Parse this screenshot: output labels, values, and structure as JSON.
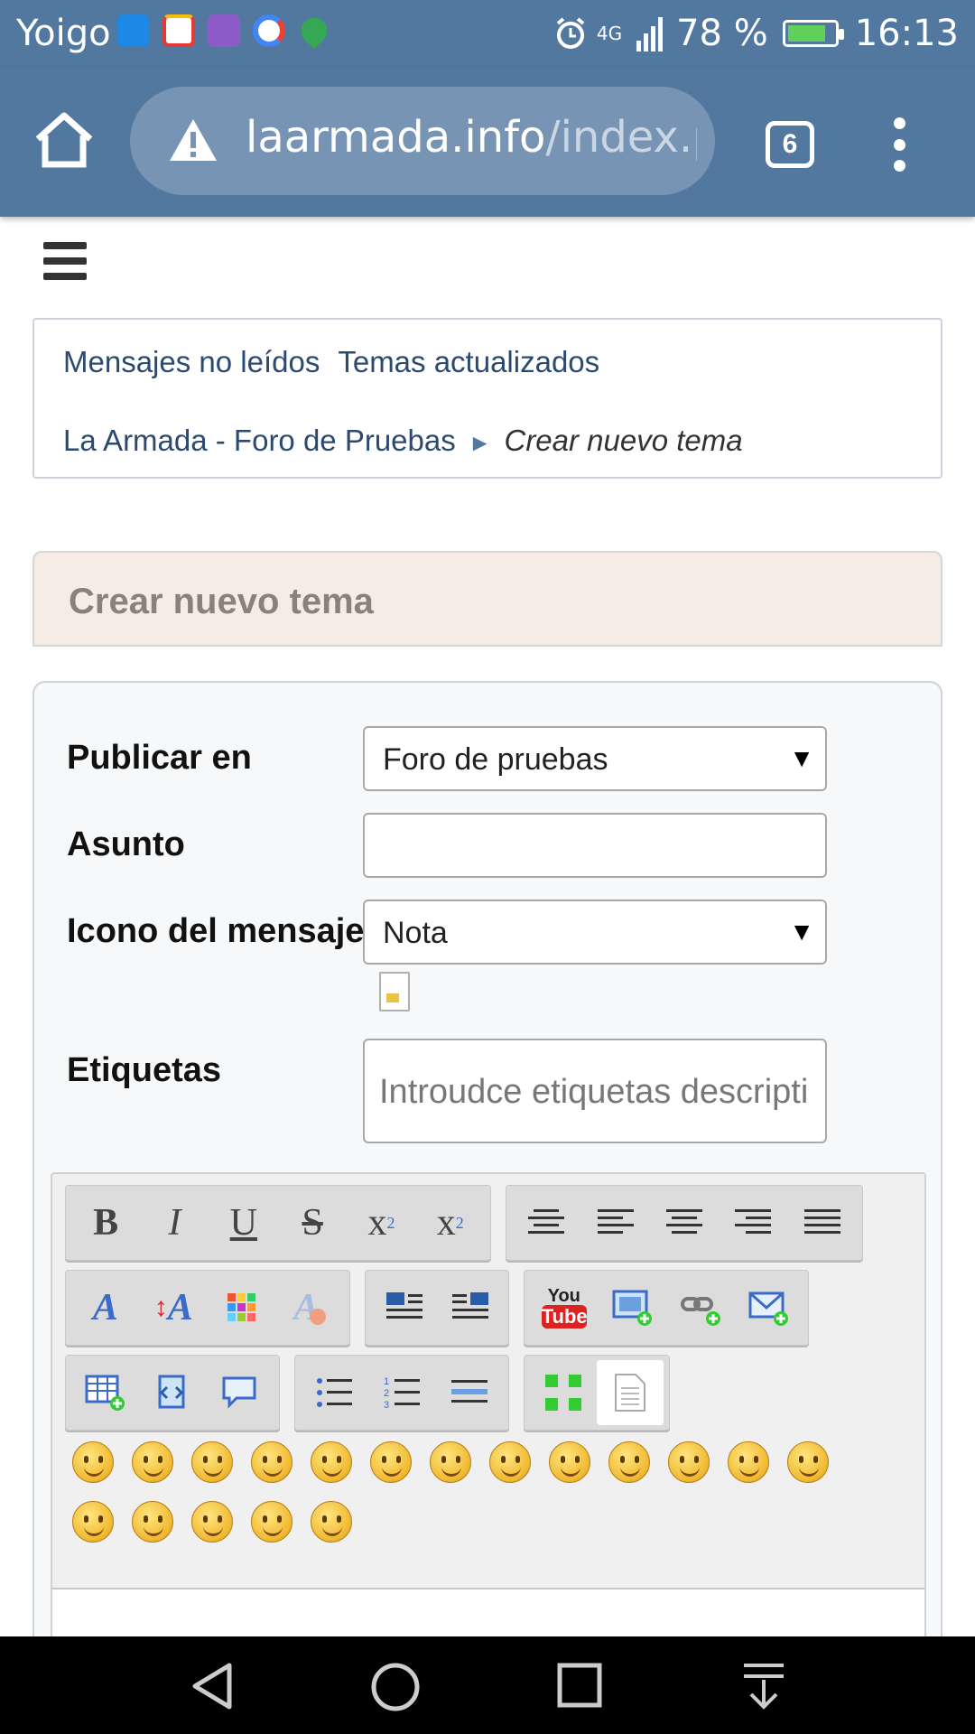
{
  "status_bar": {
    "carrier": "Yoigo",
    "network": "4G",
    "battery": "78 %",
    "battery_level": 0.78,
    "time": "16:13",
    "notification_icons": [
      "messages-icon",
      "gmail-icon",
      "gallery-icon",
      "google-icon",
      "maps-icon"
    ],
    "colors": {
      "bar": "#5278a0"
    }
  },
  "browser": {
    "url_host": "laarmada.info",
    "url_path": "/index.ph",
    "tab_count": "6"
  },
  "nav": {
    "links": [
      "Mensajes no leídos",
      "Temas actualizados"
    ],
    "breadcrumb": {
      "root": "La Armada - Foro de Pruebas",
      "separator": "►",
      "current": "Crear nuevo tema"
    }
  },
  "page": {
    "title": "Crear nuevo tema"
  },
  "form": {
    "publish_label": "Publicar en",
    "publish_value": "Foro de pruebas",
    "subject_label": "Asunto",
    "subject_value": "",
    "icon_label": "Icono del mensaje",
    "icon_value": "Nota",
    "tags_label": "Etiquetas",
    "tags_placeholder": "Introudce etiquetas descriptivas"
  },
  "editor": {
    "row1_format": [
      "bold-icon",
      "italic-icon",
      "underline-icon",
      "strikethrough-icon",
      "superscript-icon",
      "subscript-icon"
    ],
    "row1_align": [
      "align-center-icon",
      "align-left-icon",
      "align-center2-icon",
      "align-right-icon",
      "justify-icon"
    ],
    "row2_font": [
      "font-face-icon",
      "font-size-icon",
      "font-color-icon",
      "remove-format-icon"
    ],
    "row2_float": [
      "float-left-icon",
      "float-right-icon"
    ],
    "row2_insert": [
      "youtube-icon",
      "insert-image-icon",
      "insert-link-icon",
      "insert-email-icon"
    ],
    "row3_block": [
      "insert-table-icon",
      "insert-code-icon",
      "insert-quote-icon"
    ],
    "row3_list": [
      "bullet-list-icon",
      "numbered-list-icon",
      "horizontal-rule-icon"
    ],
    "row3_view": [
      "maximize-icon",
      "source-view-icon"
    ],
    "youtube_label": {
      "top": "You",
      "bottom": "Tube"
    },
    "smiley_count": 18
  }
}
